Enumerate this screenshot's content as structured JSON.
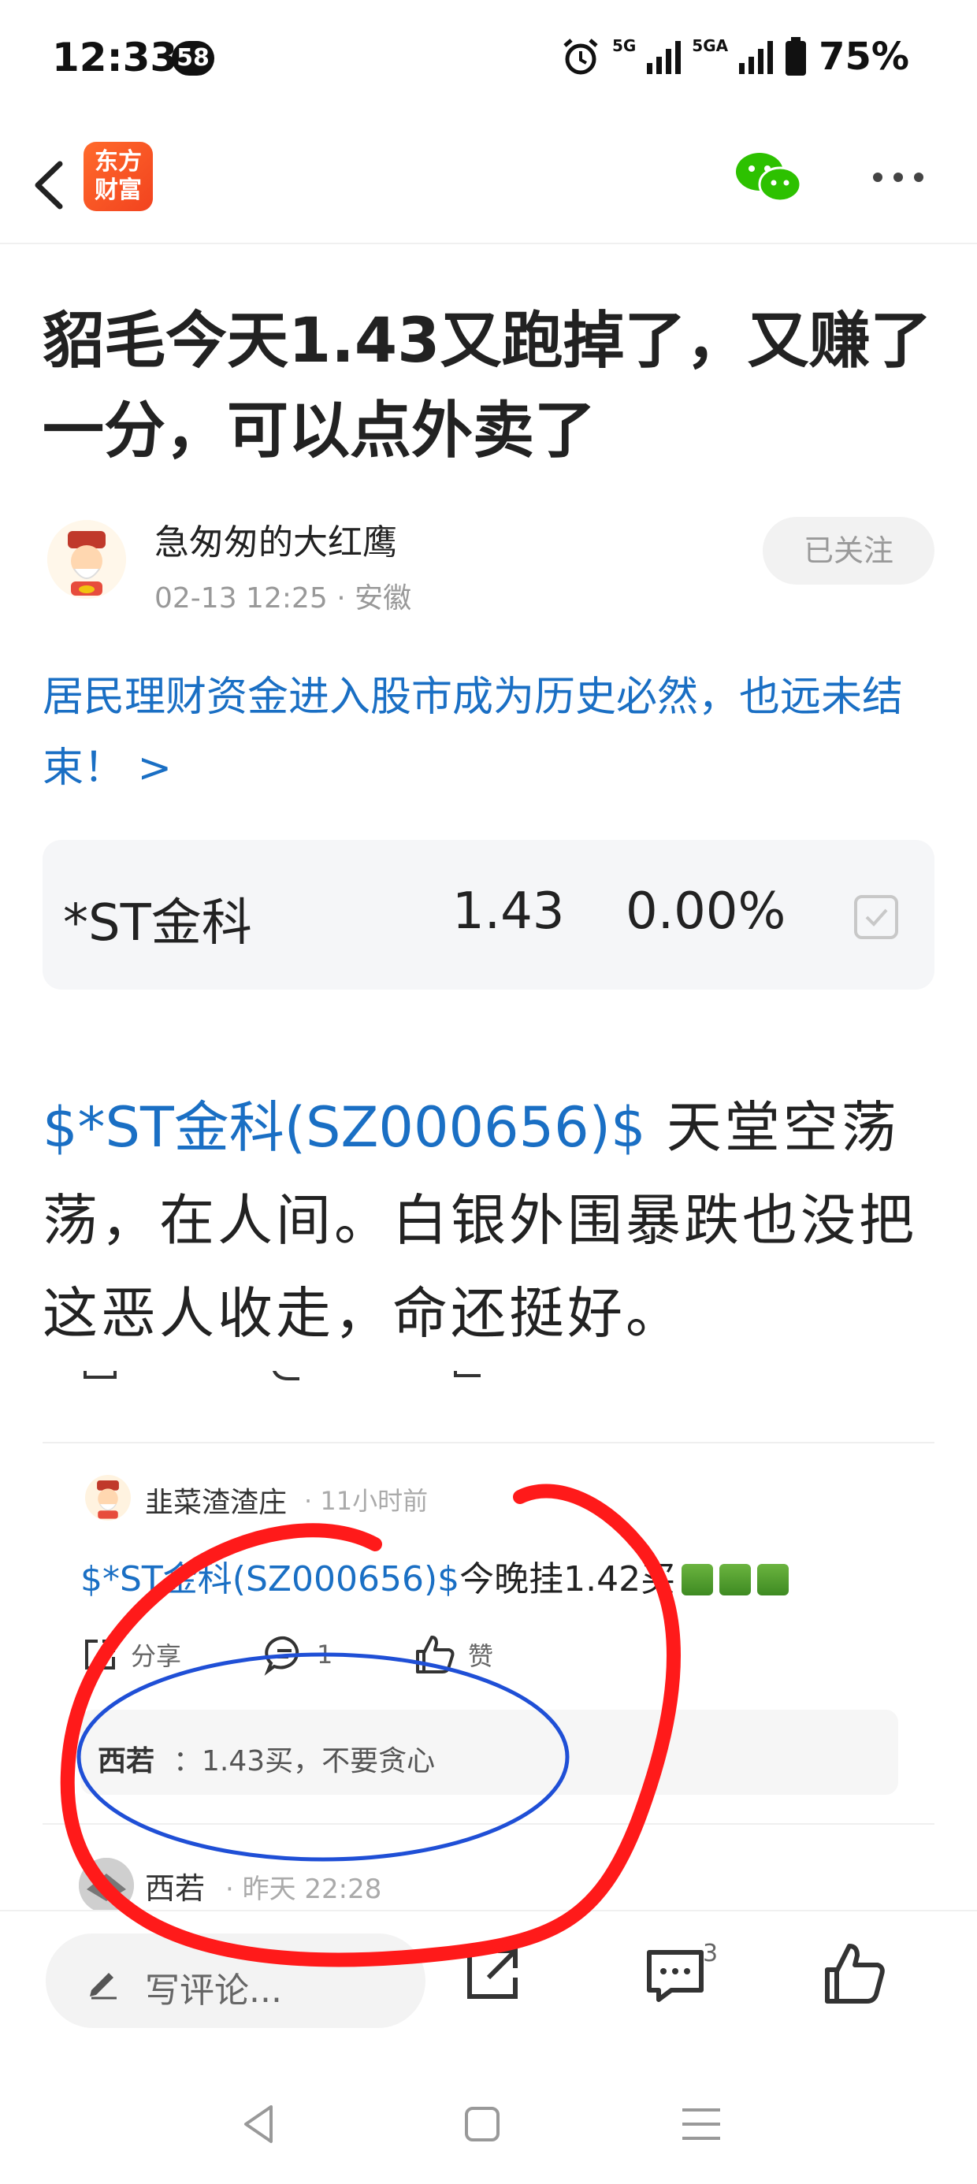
{
  "status_bar": {
    "time": "12:33",
    "notification_count": "58",
    "network_1": "5G",
    "network_2": "5GA",
    "battery": "75%"
  },
  "nav": {
    "logo_text_line1": "东方",
    "logo_text_line2": "财富",
    "icons": [
      "back-icon",
      "wechat-icon",
      "more-icon"
    ]
  },
  "article": {
    "title": "貂毛今天1.43又跑掉了，又赚了一分，可以点外卖了",
    "author": "急匆匆的大红鹰",
    "meta": "02-13 12:25 · 安徽",
    "follow_label": "已关注",
    "promo_link": "居民理财资金进入股市成为历史必然，也远未结束！ >",
    "stock_card": {
      "name": "*ST金科",
      "price": "1.43",
      "change": "0.00%"
    },
    "body_tag": "$*ST金科(SZ000656)$",
    "body_text": " 天堂空荡荡，在人间。白银外围暴跌也没把这恶人收走，命还挺好。"
  },
  "comment": {
    "user": "韭菜渣渣庄",
    "time": "· 11小时前",
    "tag": "$*ST金科(SZ000656)$",
    "text": "今晚挂1.42买",
    "share_label": "分享",
    "reply_count": "1",
    "like_label": "赞",
    "reply": {
      "user": "西若",
      "text": "：1.43买，不要贪心"
    }
  },
  "comment2": {
    "user": "西若",
    "time": "· 昨天 22:28"
  },
  "bottom_bar": {
    "write_placeholder": "写评论...",
    "comment_count": "3"
  },
  "colors": {
    "link_blue": "#1a6fc4",
    "annotation_red": "#ff1a1a",
    "annotation_blue": "#1f4fd6",
    "logo_orange": "#f2431f"
  }
}
